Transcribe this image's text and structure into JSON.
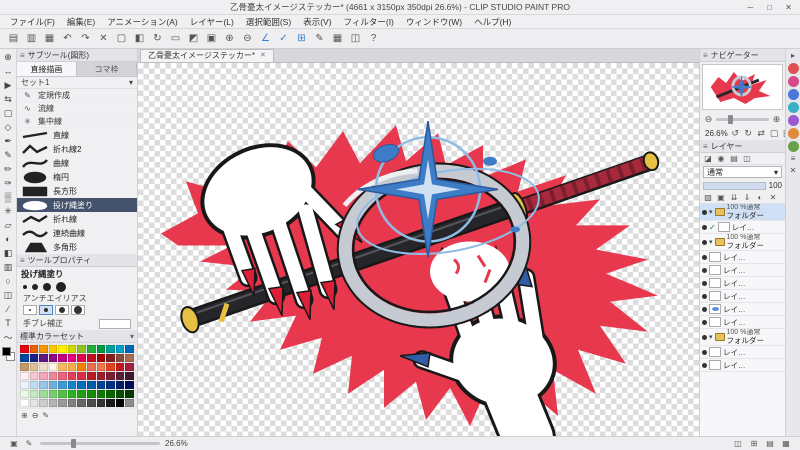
{
  "ui": {
    "panel_menu_glyph": "≡",
    "caret_down": "▾",
    "close_glyph": "✕"
  },
  "window": {
    "title": "乙骨憂太イメージステッカー* (4661 x 3150px 350dpi 26.6%) - CLIP STUDIO PAINT PRO",
    "controls": [
      "─",
      "□",
      "✕"
    ]
  },
  "menu": {
    "items": [
      "ファイル(F)",
      "編集(E)",
      "アニメーション(A)",
      "レイヤー(L)",
      "選択範囲(S)",
      "表示(V)",
      "フィルター(I)",
      "ウィンドウ(W)",
      "ヘルプ(H)"
    ]
  },
  "toolbar": {
    "icons": [
      {
        "name": "new-file-icon",
        "glyph": "▤"
      },
      {
        "name": "open-file-icon",
        "glyph": "▥"
      },
      {
        "name": "save-icon",
        "glyph": "▦"
      },
      {
        "name": "undo-icon",
        "glyph": "↶"
      },
      {
        "name": "redo-icon",
        "glyph": "↷"
      },
      {
        "name": "delete-icon",
        "glyph": "✕"
      },
      {
        "name": "delete-outside-selection-icon",
        "glyph": "▢"
      },
      {
        "name": "fill-icon",
        "glyph": "◧"
      },
      {
        "name": "scale-rotate-icon",
        "glyph": "↻"
      },
      {
        "name": "deselect-icon",
        "glyph": "▭"
      },
      {
        "name": "invert-selection-icon",
        "glyph": "◩"
      },
      {
        "name": "border-selection-icon",
        "glyph": "▣"
      },
      {
        "name": "zoom-in-icon",
        "glyph": "⊕"
      },
      {
        "name": "zoom-out-icon",
        "glyph": "⊖"
      },
      {
        "name": "snap-ruler-icon",
        "glyph": "∠",
        "color": "#3b7fd0"
      },
      {
        "name": "snap-special-ruler-icon",
        "glyph": "✓",
        "color": "#3b7fd0"
      },
      {
        "name": "snap-grid-icon",
        "glyph": "⊞",
        "color": "#3b7fd0"
      },
      {
        "name": "pen-settings-icon",
        "glyph": "✎"
      },
      {
        "name": "grid-toggle-icon",
        "glyph": "▦"
      },
      {
        "name": "material-icon",
        "glyph": "◫"
      },
      {
        "name": "help-icon",
        "glyph": "?"
      }
    ]
  },
  "toolstrip": {
    "icons": [
      {
        "name": "zoom-tool",
        "glyph": "⊕"
      },
      {
        "name": "move-tool",
        "glyph": "↔"
      },
      {
        "name": "operation-tool",
        "glyph": "▶"
      },
      {
        "name": "layer-move-tool",
        "glyph": "⇆"
      },
      {
        "name": "selection-tool",
        "glyph": "▢"
      },
      {
        "name": "auto-select-tool",
        "glyph": "◇"
      },
      {
        "name": "eyedropper-tool",
        "glyph": "✒"
      },
      {
        "name": "pen-tool",
        "glyph": "✎"
      },
      {
        "name": "pencil-tool",
        "glyph": "✏"
      },
      {
        "name": "brush-tool",
        "glyph": "✑"
      },
      {
        "name": "airbrush-tool",
        "glyph": "▒"
      },
      {
        "name": "decoration-tool",
        "glyph": "✳"
      },
      {
        "name": "eraser-tool",
        "glyph": "▱"
      },
      {
        "name": "blend-tool",
        "glyph": "◐"
      },
      {
        "name": "fill-tool",
        "glyph": "◧"
      },
      {
        "name": "gradient-tool",
        "glyph": "▥"
      },
      {
        "name": "figure-tool",
        "glyph": "○"
      },
      {
        "name": "frame-border-tool",
        "glyph": "◫"
      },
      {
        "name": "ruler-tool",
        "glyph": "∕"
      },
      {
        "name": "text-tool",
        "glyph": "T"
      },
      {
        "name": "line-correction-tool",
        "glyph": "〜"
      }
    ],
    "main_color": "#000000",
    "sub_color": "#ffffff"
  },
  "subtool": {
    "title": "サブツール(図形)",
    "tabs": [
      {
        "label": "直接描画",
        "active": true
      },
      {
        "label": "コマ枠",
        "active": false
      }
    ],
    "set_label": "セット1",
    "groups": [
      {
        "label": "定規作成",
        "glyph": "✎"
      },
      {
        "label": "流線",
        "glyph": "∿"
      },
      {
        "label": "集中線",
        "glyph": "✳"
      }
    ],
    "tools": [
      {
        "label": "直線",
        "shape": "line"
      },
      {
        "label": "折れ線2",
        "shape": "zigzag"
      },
      {
        "label": "曲線",
        "shape": "curve"
      },
      {
        "label": "楕円",
        "shape": "ellipse"
      },
      {
        "label": "長方形",
        "shape": "rect"
      },
      {
        "label": "投げ縄塗り",
        "shape": "lasso",
        "selected": true
      },
      {
        "label": "折れ線",
        "shape": "polyline"
      },
      {
        "label": "連続曲線",
        "shape": "curve2"
      },
      {
        "label": "多角形",
        "shape": "polygon"
      }
    ]
  },
  "tool_property": {
    "title": "ツールプロパティ",
    "tool_name": "投げ縄塗り",
    "antialias_label": "アンチエイリアス",
    "stabilize_label": "手ブレ補正"
  },
  "color_set": {
    "title": "標準カラーセット",
    "colors": [
      "#e60012",
      "#eb6100",
      "#f39800",
      "#fcc800",
      "#fff100",
      "#cfdb00",
      "#8fc31f",
      "#22ac38",
      "#009944",
      "#009e96",
      "#00a0c9",
      "#0068b7",
      "#00479d",
      "#1d2088",
      "#601986",
      "#920783",
      "#be0081",
      "#e4007f",
      "#e5004f",
      "#c30d23",
      "#a40000",
      "#7f1f1f",
      "#884c3a",
      "#aa6b4f",
      "#c49a6c",
      "#dbc091",
      "#efe0c9",
      "#fff5e1",
      "#f8b862",
      "#f6ad49",
      "#f08300",
      "#ec6d51",
      "#ee7948",
      "#e2421f",
      "#c8161d",
      "#a22041",
      "#fdeff2",
      "#f9c9d2",
      "#f4a7b9",
      "#ee869a",
      "#e8637c",
      "#e2415e",
      "#db2e44",
      "#b81c22",
      "#9a1f2e",
      "#7b1e33",
      "#5c1e35",
      "#42192c",
      "#eaf4fc",
      "#c0def2",
      "#95c8e8",
      "#6ab1dd",
      "#3f9ad3",
      "#1583c8",
      "#006ebd",
      "#0059a9",
      "#004494",
      "#00307f",
      "#001d6a",
      "#000b55",
      "#eaf8e8",
      "#c4ebc0",
      "#9edd98",
      "#78cf70",
      "#52c148",
      "#2cb320",
      "#1fa012",
      "#178c0a",
      "#0f7802",
      "#0a6400",
      "#065000",
      "#033c00",
      "#ffffff",
      "#e6e6e6",
      "#cccccc",
      "#b3b3b3",
      "#999999",
      "#7f7f7f",
      "#666666",
      "#4c4c4c",
      "#333333",
      "#191919",
      "#000000",
      "#8c8c8c"
    ],
    "footer_icons": [
      {
        "name": "add-color-icon",
        "glyph": "⊕"
      },
      {
        "name": "remove-color-icon",
        "glyph": "⊖"
      },
      {
        "name": "edit-color-icon",
        "glyph": "✎"
      }
    ]
  },
  "canvas": {
    "tab_label": "乙骨憂太イメージステッカー*"
  },
  "navigator": {
    "title": "ナビゲーター",
    "zoom_label": "26.6%",
    "zoom_out_glyph": "⊖",
    "zoom_in_glyph": "⊕",
    "row_icons": [
      {
        "name": "rotate-left-icon",
        "glyph": "↺"
      },
      {
        "name": "rotate-right-icon",
        "glyph": "↻"
      },
      {
        "name": "flip-horizontal-icon",
        "glyph": "⇄"
      },
      {
        "name": "reset-display-icon",
        "glyph": "▢"
      },
      {
        "name": "fit-to-screen-icon",
        "glyph": "◱"
      },
      {
        "name": "actual-size-icon",
        "glyph": "▣"
      }
    ]
  },
  "layers": {
    "title": "レイヤー",
    "palette_icons": [
      {
        "name": "layer-color-icon",
        "glyph": "◪"
      },
      {
        "name": "layer-search-icon",
        "glyph": "◉"
      },
      {
        "name": "layer-property-icon",
        "glyph": "▤"
      },
      {
        "name": "two-pane-icon",
        "glyph": "◫"
      }
    ],
    "blend_mode": "通常",
    "opacity_value": "100",
    "toolbar_icons": [
      {
        "name": "new-layer-icon",
        "glyph": "▧"
      },
      {
        "name": "new-folder-icon",
        "glyph": "▣"
      },
      {
        "name": "transfer-down-icon",
        "glyph": "⇊"
      },
      {
        "name": "merge-down-icon",
        "glyph": "⇓"
      },
      {
        "name": "layer-mask-icon",
        "glyph": "◐"
      },
      {
        "name": "delete-layer-icon",
        "glyph": "✕"
      }
    ],
    "rows": [
      {
        "kind": "folder",
        "mode": "100 %通常",
        "name": "フォルダー",
        "selected": true
      },
      {
        "kind": "layer-small",
        "name": "レイ…",
        "thumb": "white",
        "check": true
      },
      {
        "kind": "folder",
        "mode": "100 %通常",
        "name": "フォルダー"
      },
      {
        "kind": "layer-small",
        "name": "レイ…",
        "thumb": "white"
      },
      {
        "kind": "layer-small",
        "name": "レイ…",
        "thumb": "white"
      },
      {
        "kind": "layer-small",
        "name": "レイ…",
        "thumb": "white"
      },
      {
        "kind": "layer-small",
        "name": "レイ…",
        "thumb": "white"
      },
      {
        "kind": "layer-small",
        "name": "レイ…",
        "thumb": "blue"
      },
      {
        "kind": "layer-small",
        "name": "レイ…",
        "thumb": "white"
      },
      {
        "kind": "folder",
        "mode": "100 %通常",
        "name": "フォルダー"
      },
      {
        "kind": "layer-small",
        "name": "レイ…",
        "thumb": "white"
      },
      {
        "kind": "layer-small",
        "name": "レイ…",
        "thumb": "white"
      }
    ]
  },
  "rightstrip": {
    "icons": [
      {
        "shape": "sq",
        "name": "collapse-panel-icon",
        "glyph": "▸"
      },
      {
        "shape": "circle",
        "name": "quick-access-icon",
        "color": "#e05252"
      },
      {
        "shape": "circle",
        "name": "material-download-icon",
        "color": "#d84a8a"
      },
      {
        "shape": "circle",
        "name": "material-color-pattern-icon",
        "color": "#4a78d8"
      },
      {
        "shape": "circle",
        "name": "material-monochrome-icon",
        "color": "#3ab0c4"
      },
      {
        "shape": "circle",
        "name": "material-manga-icon",
        "color": "#9a5ad0"
      },
      {
        "shape": "circle",
        "name": "material-image-icon",
        "color": "#e08a3a"
      },
      {
        "shape": "circle",
        "name": "material-3d-icon",
        "color": "#6aa04a"
      },
      {
        "shape": "sq",
        "name": "material-list-icon",
        "glyph": "≡"
      },
      {
        "shape": "sq",
        "name": "material-trash-icon",
        "glyph": "✕"
      }
    ]
  },
  "statusbar": {
    "left_icons": [
      {
        "name": "canvas-info-icon",
        "glyph": "▣"
      },
      {
        "name": "pen-pressure-status-icon",
        "glyph": "✎"
      }
    ],
    "zoom_label": "26.6%",
    "right_icons": [
      {
        "name": "palette-dock-icon",
        "glyph": "◫"
      },
      {
        "name": "grid-status-icon",
        "glyph": "⊞"
      },
      {
        "name": "material-dock-icon",
        "glyph": "▤"
      },
      {
        "name": "workspace-icon",
        "glyph": "▦"
      }
    ]
  },
  "artwork": {
    "colors": {
      "red": "#e8384e",
      "outline": "#181818",
      "ring": "#c6cad2",
      "ringlight": "#edeff3",
      "gold": "#e5c043",
      "grip": "#a62a3c",
      "gripdark": "#7d1e2e",
      "spark": "#3f7cc7",
      "sparklight": "#cfe0f2",
      "lightblue": "#8fbce4",
      "nailred": "#dd1f38",
      "nailblue": "#2f5ea6",
      "sheath": "#26262a"
    }
  }
}
